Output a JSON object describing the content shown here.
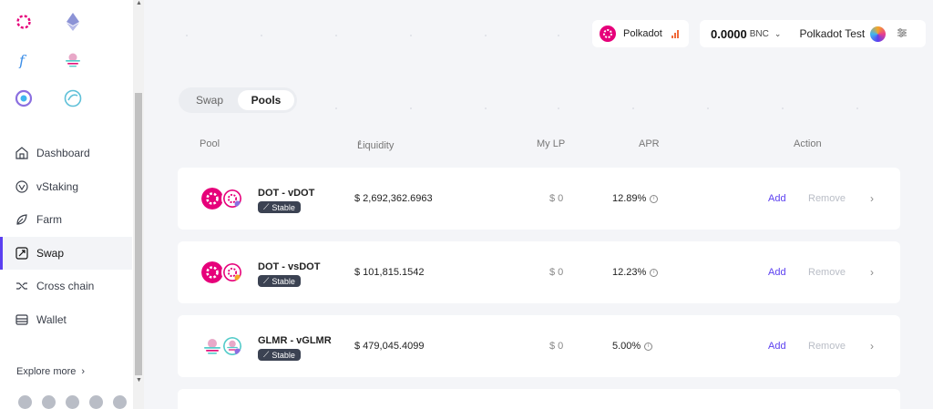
{
  "header": {
    "network": "Polkadot",
    "balance": "0.0000",
    "balance_unit": "BNC",
    "account_name": "Polkadot Test"
  },
  "sidebar": {
    "items": [
      {
        "label": "Dashboard",
        "icon": "dashboard-icon"
      },
      {
        "label": "vStaking",
        "icon": "vstaking-icon"
      },
      {
        "label": "Farm",
        "icon": "farm-icon"
      },
      {
        "label": "Swap",
        "icon": "swap-icon"
      },
      {
        "label": "Cross chain",
        "icon": "cross-chain-icon"
      },
      {
        "label": "Wallet",
        "icon": "wallet-icon"
      }
    ],
    "active": "Swap",
    "explore": "Explore more"
  },
  "tabs": [
    {
      "label": "Swap"
    },
    {
      "label": "Pools"
    }
  ],
  "table": {
    "headers": {
      "pool": "Pool",
      "liquidity": "Liquidity",
      "my_lp": "My LP",
      "apr": "APR",
      "action": "Action"
    },
    "rows": [
      {
        "name": "DOT - vDOT",
        "badge": "Stable",
        "liquidity": "$ 2,692,362.6963",
        "my_lp": "$ 0",
        "apr": "12.89%",
        "add": "Add",
        "remove": "Remove"
      },
      {
        "name": "DOT - vsDOT",
        "badge": "Stable",
        "liquidity": "$ 101,815.1542",
        "my_lp": "$ 0",
        "apr": "12.23%",
        "add": "Add",
        "remove": "Remove"
      },
      {
        "name": "GLMR - vGLMR",
        "badge": "Stable",
        "liquidity": "$ 479,045.4099",
        "my_lp": "$ 0",
        "apr": "5.00%",
        "add": "Add",
        "remove": "Remove"
      }
    ]
  },
  "colors": {
    "accent": "#5b3ff0",
    "polkadot": "#e6007a",
    "badge_bg": "#3b4252"
  }
}
